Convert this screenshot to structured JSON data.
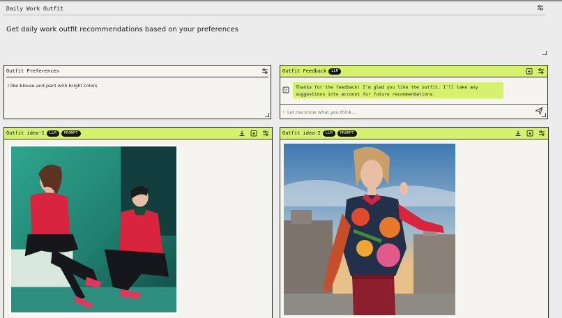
{
  "app": {
    "title": "Daily Work Outfit",
    "description": "Get daily work outfit recommendations based on your preferences"
  },
  "preferences": {
    "title": "Outfit Preferences",
    "text": "I like blouse and pant with bright colors"
  },
  "feedback": {
    "title": "Outfit Feedback",
    "badge": "LLM",
    "response": "Thanks for the feedback! I'm glad you like the outfit. I'll take any suggestions into account for future recommendations.",
    "input_placeholder": "Let me know what you think..."
  },
  "ideas": [
    {
      "title": "Outfit idea-1",
      "badges": [
        "LLM",
        "PROMPT"
      ]
    },
    {
      "title": "Outfit idea-2",
      "badges": [
        "LLM",
        "PROMPT"
      ]
    }
  ],
  "colors": {
    "accent": "#d6f16e",
    "background": "#ececec",
    "panel": "#f5f4ee",
    "badge": "#141414"
  },
  "icons": [
    "sliders-icon",
    "download-icon",
    "save-icon",
    "send-icon",
    "bot-icon"
  ]
}
